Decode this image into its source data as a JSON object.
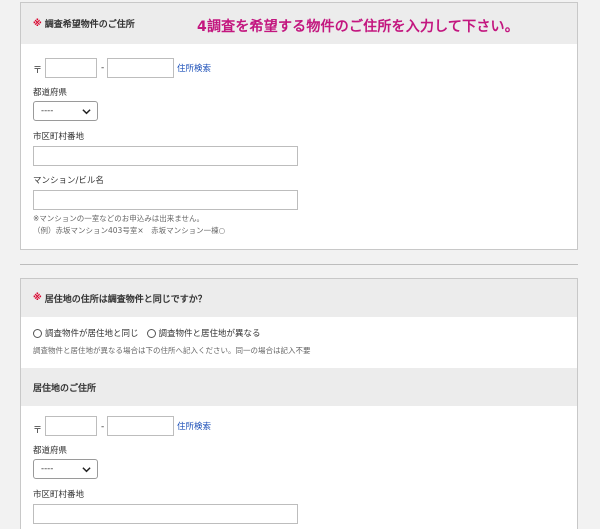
{
  "annotation": "4調査を希望する物件のご住所を入力して下さい。",
  "section1": {
    "required_mark": "※",
    "title": "調査希望物件のご住所",
    "postal_mark": "〒",
    "postal_dash": "-",
    "postal_search": "住所検索",
    "prefecture_label": "都道府県",
    "prefecture_value": "----",
    "city_label": "市区町村番地",
    "building_label": "マンション/ビル名",
    "note_line1": "※マンションの一室などのお申込みは出来ません。",
    "note_line2": "（例）赤坂マンション403号室×　赤坂マンション一棟○"
  },
  "section2": {
    "required_mark": "※",
    "title": "居住地の住所は調査物件と同じですか？",
    "option_same": "調査物件が居住地と同じ",
    "option_diff": "調査物件と居住地が異なる",
    "instruction": "調査物件と居住地が異なる場合は下の住所へ記入ください。同一の場合は記入不要",
    "subsection_title": "居住地のご住所",
    "postal_mark": "〒",
    "postal_dash": "-",
    "postal_search": "住所検索",
    "prefecture_label": "都道府県",
    "prefecture_value": "----",
    "city_label": "市区町村番地"
  }
}
